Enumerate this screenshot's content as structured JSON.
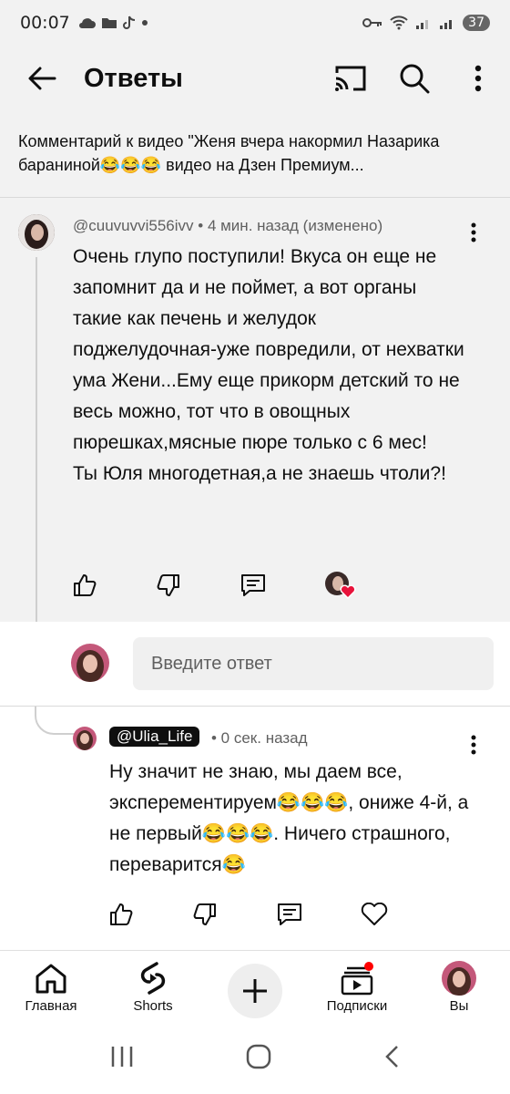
{
  "status_bar": {
    "time": "00:07",
    "battery": "37"
  },
  "app_bar": {
    "title": "Ответы"
  },
  "context": {
    "text": "Комментарий к видео \"Женя вчера накормил Назарика бараниной😂😂😂 видео на Дзен Премиум..."
  },
  "parent_comment": {
    "author": "@cuuvuvvi556ivv",
    "meta_suffix": " • 4 мин. назад (изменено)",
    "text": "Очень глупо поступили! Вкуса он еще не запомнит да и не поймет, а вот органы такие как печень и желудок поджелудочная-уже повредили, от нехватки ума Жени...Ему еще прикорм детский то не весь можно, тот что в овощных пюрешках,мясные пюре только с 6 мес!\nТы Юля многодетная,а не знаешь чтоли?!"
  },
  "reply_input": {
    "placeholder": "Введите ответ"
  },
  "reply_comment": {
    "author": "@Ulia_Life",
    "meta_suffix": " • 0 сек. назад",
    "text": "Ну значит не знаю, мы даем все, эксперементируем😂😂😂, ониже 4-й, а не первый😂😂😂. Ничего страшного, переварится😂"
  },
  "bottom_nav": {
    "items": [
      {
        "label": "Главная"
      },
      {
        "label": "Shorts"
      },
      {
        "label": ""
      },
      {
        "label": "Подписки"
      },
      {
        "label": "Вы"
      }
    ]
  },
  "colors": {
    "accent_red": "#ff0000",
    "heart": "#e8133b"
  }
}
